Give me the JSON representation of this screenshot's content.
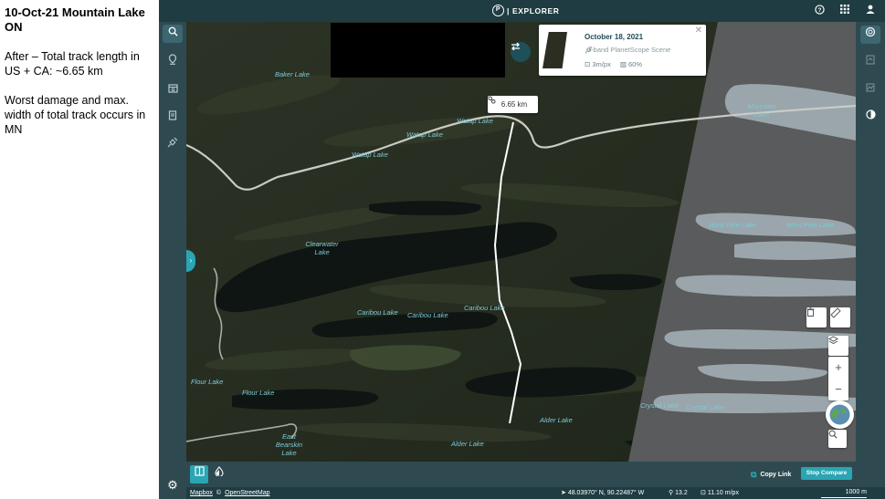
{
  "notes": {
    "title": "10-Oct-21 Mountain Lake ON",
    "line1": "After – Total track length in US + CA: ~6.65 km",
    "line2": "Worst damage and max. width of total track occurs in MN"
  },
  "app": {
    "brand": "| EXPLORER",
    "brand_logo": "P"
  },
  "scene": {
    "date": "October 18, 2021",
    "type": "3-band PlanetScope Scene",
    "resolution": "3m/px",
    "cloud": "60%"
  },
  "measure": {
    "distance": "6.65 km"
  },
  "lakes": {
    "baker": "Baker Lake",
    "watap1": "Watap Lake",
    "watap2": "Watap Lake",
    "watap3": "Watap Lake",
    "mountain": "Mountain Lake",
    "clearwater": "Clearwater Lake",
    "caribou1": "Caribou Lake",
    "caribou2": "Caribou Lake",
    "caribou3": "Caribou Lake",
    "westpike1": "West Pike Lake",
    "westpike2": "West Pike Lake",
    "flour1": "Flour Lake",
    "flour2": "Flour Lake",
    "eastbearskin": "East Bearskin Lake",
    "alder1": "Alder Lake",
    "alder2": "Alder Lake",
    "crystal1": "Crystal Lake",
    "crystal2": "Crystal Lake"
  },
  "bottom": {
    "copy_link": "Copy Link",
    "stop_compare": "Stop Compare"
  },
  "status": {
    "mapbox": "Mapbox",
    "osm": "OpenStreetMap",
    "coords": "48.03970° N, 90.22487° W",
    "zoom": "13.2",
    "resolution": "11.10 m/px",
    "scale": "1000 m"
  },
  "icons": {
    "search": "search-icon",
    "pin": "location-pin-icon",
    "calendar": "calendar-icon",
    "document": "document-icon",
    "satellite": "satellite-icon",
    "help": "help-icon",
    "apps": "apps-grid-icon",
    "user": "user-icon",
    "trash": "trash-icon",
    "ruler": "ruler-icon",
    "layers": "layers-icon",
    "settings": "gear-icon"
  },
  "colors": {
    "accent": "#2aa5b3",
    "header": "#1f3c43",
    "panel": "#2e4a50",
    "lake_text": "#7ec9d6"
  }
}
